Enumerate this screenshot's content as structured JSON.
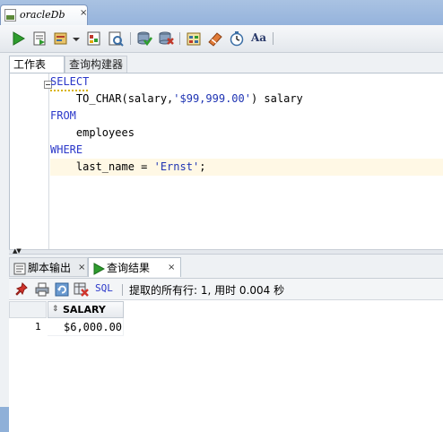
{
  "document_tab": {
    "title": "oracleDb",
    "close": "×"
  },
  "toolbar": {
    "icons": [
      "run-statement-icon",
      "run-script-icon",
      "autotrace-icon",
      "dropdown-icon",
      "explain-plan-icon",
      "sql-tuning-icon",
      "commit-icon",
      "rollback-icon",
      "sql-history-icon",
      "clear-icon",
      "unshared-worksheet-icon",
      "format-icon"
    ],
    "format_label": "Aa"
  },
  "worksheet_tabs": [
    {
      "label": "工作表",
      "active": true
    },
    {
      "label": "查询构建器",
      "active": false
    }
  ],
  "editor": {
    "lines": [
      {
        "indent": "",
        "tokens": [
          {
            "t": "SELECT",
            "k": "kw"
          }
        ]
      },
      {
        "indent": "    ",
        "tokens": [
          {
            "t": "TO_CHAR(salary,",
            "k": ""
          },
          {
            "t": "'$99,999.00'",
            "k": "str"
          },
          {
            "t": ") salary",
            "k": ""
          }
        ]
      },
      {
        "indent": "",
        "tokens": [
          {
            "t": "FROM",
            "k": "kw"
          }
        ]
      },
      {
        "indent": "    ",
        "tokens": [
          {
            "t": "employees",
            "k": ""
          }
        ]
      },
      {
        "indent": "",
        "tokens": [
          {
            "t": "WHERE",
            "k": "kw"
          }
        ]
      },
      {
        "indent": "    ",
        "tokens": [
          {
            "t": "last_name = ",
            "k": ""
          },
          {
            "t": "'Ernst'",
            "k": "str"
          },
          {
            "t": ";",
            "k": ""
          }
        ]
      }
    ],
    "current_line": 6
  },
  "lower_tabs": [
    {
      "label": "脚本输出",
      "close": "×",
      "active": false
    },
    {
      "label": "查询结果",
      "close": "×",
      "active": true
    }
  ],
  "results_toolbar": {
    "sql_label": "SQL",
    "status": "提取的所有行: 1, 用时 0.004 秒"
  },
  "grid": {
    "columns": [
      "SALARY"
    ],
    "rows": [
      {
        "num": "1",
        "cells": [
          "$6,000.00"
        ]
      }
    ]
  },
  "colors": {
    "keyword": "#2a37c9",
    "current_line": "#fff8e5",
    "run_green": "#2e9c2e"
  }
}
